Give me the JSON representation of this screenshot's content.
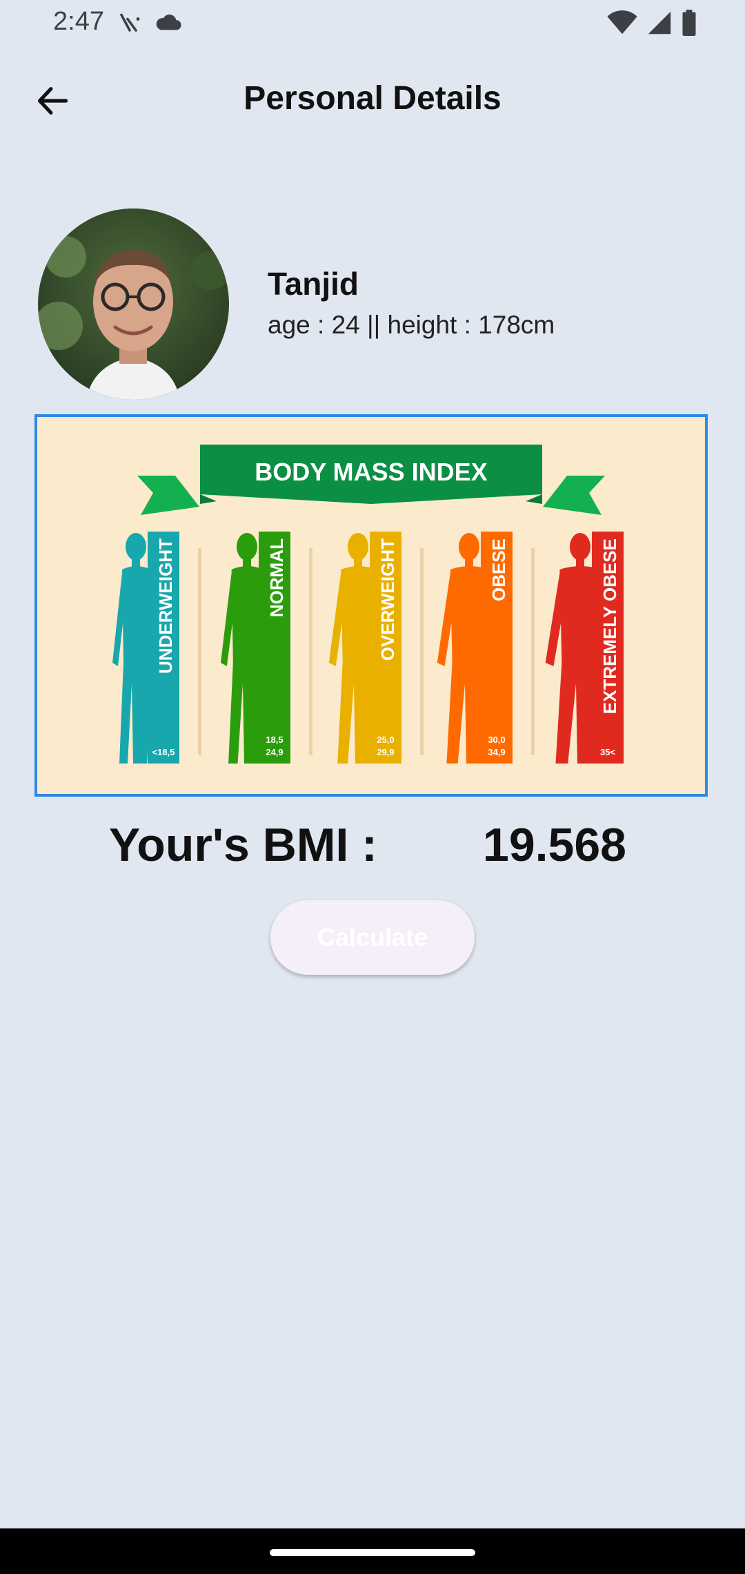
{
  "status_bar": {
    "time": "2:47",
    "left_icons": [
      "call-missed-icon",
      "cloud-icon"
    ],
    "right_icons": [
      "wifi-icon",
      "signal-icon",
      "battery-icon"
    ]
  },
  "app_bar": {
    "back_icon": "arrow-back-icon",
    "title": "Personal Details"
  },
  "profile": {
    "name": "Tanjid",
    "details": "age : 24 || height : 178cm"
  },
  "bmi_chart": {
    "title": "BODY MASS INDEX",
    "categories": [
      {
        "label": "UNDERWEIGHT",
        "range_line1": "<18,5",
        "range_line2": "",
        "color": "#18a7ad"
      },
      {
        "label": "NORMAL",
        "range_line1": "18,5",
        "range_line2": "24,9",
        "color": "#2b9d0d"
      },
      {
        "label": "OVERWEIGHT",
        "range_line1": "25,0",
        "range_line2": "29,9",
        "color": "#e9b000"
      },
      {
        "label": "OBESE",
        "range_line1": "30,0",
        "range_line2": "34,9",
        "color": "#ff6a00"
      },
      {
        "label": "EXTREMELY OBESE",
        "range_line1": "35<",
        "range_line2": "",
        "color": "#e12a1f"
      }
    ],
    "banner_color": "#0b8f45",
    "background_color": "#fceacd"
  },
  "result": {
    "label": "Your's BMI :",
    "value": "19.568"
  },
  "calculate_button": {
    "label": "Calculate"
  },
  "colors": {
    "background": "#e0e7f0",
    "card_border": "#2f88e6"
  }
}
